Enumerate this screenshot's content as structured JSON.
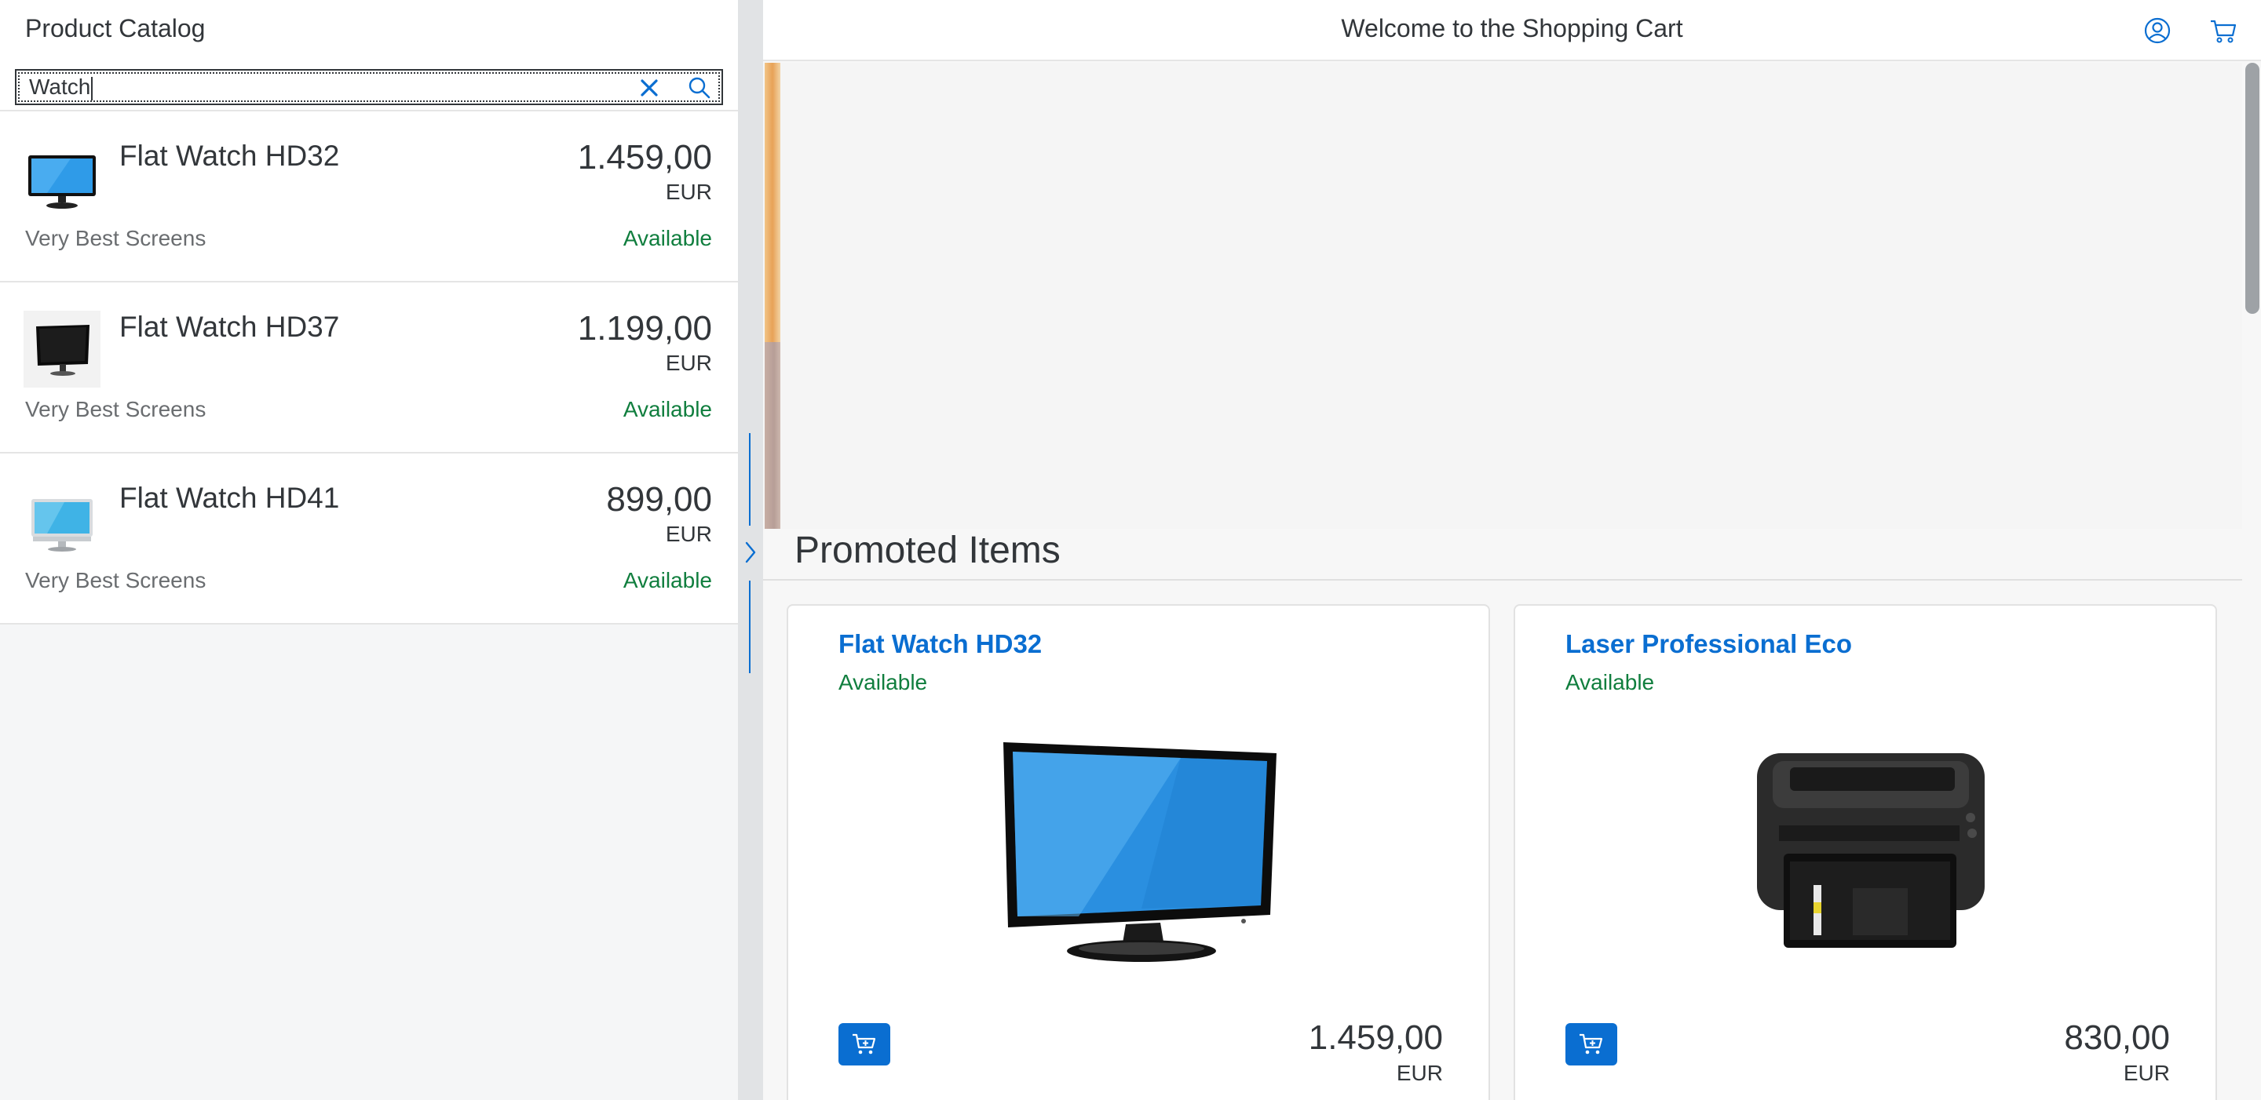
{
  "master": {
    "title": "Product Catalog",
    "search": {
      "value": "Watch"
    },
    "items": [
      {
        "name": "Flat Watch HD32",
        "price": "1.459,00",
        "currency": "EUR",
        "supplier": "Very Best Screens",
        "status": "Available",
        "icon": "monitor-thumbnail-blue"
      },
      {
        "name": "Flat Watch HD37",
        "price": "1.199,00",
        "currency": "EUR",
        "supplier": "Very Best Screens",
        "status": "Available",
        "icon": "monitor-thumbnail-black"
      },
      {
        "name": "Flat Watch HD41",
        "price": "899,00",
        "currency": "EUR",
        "supplier": "Very Best Screens",
        "status": "Available",
        "icon": "monitor-thumbnail-silver"
      }
    ]
  },
  "detail": {
    "title": "Welcome to the Shopping Cart",
    "icons": [
      "user-avatar-icon",
      "cart-icon"
    ],
    "promo_title": "Promoted Items",
    "promoted": [
      {
        "name": "Flat Watch HD32",
        "status": "Available",
        "price": "1.459,00",
        "currency": "EUR",
        "icon": "monitor-image"
      },
      {
        "name": "Laser Professional Eco",
        "status": "Available",
        "price": "830,00",
        "currency": "EUR",
        "icon": "printer-image"
      }
    ]
  },
  "colors": {
    "accent": "#0a6ed1",
    "positive": "#107e3e",
    "text": "#32363a",
    "muted_text": "#6a6d70",
    "background": "#f5f6f7"
  }
}
